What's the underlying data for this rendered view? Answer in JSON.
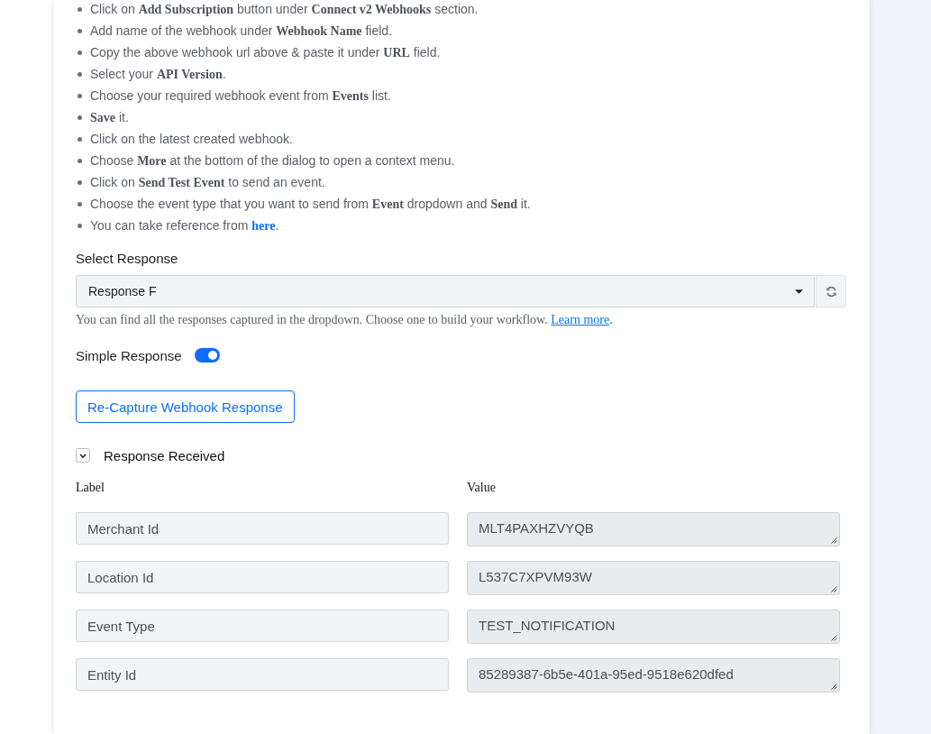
{
  "instructions": [
    {
      "text": "Click on **Add Subscription** button under **Connect v2 Webhooks** section."
    },
    {
      "text": "Add name of the webhook under **Webhook Name** field."
    },
    {
      "text": "Copy the above webhook url above & paste it under **URL** field."
    },
    {
      "text": "Select your **API Version**."
    },
    {
      "text": "Choose your required webhook event from **Events** list."
    },
    {
      "text": "**Save** it."
    },
    {
      "text": "Click on the latest created webhook."
    },
    {
      "text": "Choose **More** at the bottom of the dialog to open a context menu."
    },
    {
      "text": "Click on **Send Test Event** to send an event."
    },
    {
      "text": "Choose the event type that you want to send from **Event** dropdown and **Send** it."
    },
    {
      "text": "You can take reference from ",
      "link": "here",
      "after": "."
    }
  ],
  "select_response": {
    "label": "Select Response",
    "value": "Response F",
    "help_text": "You can find all the responses captured in the dropdown. Choose one to build your workflow. ",
    "help_link": "Learn more",
    "help_after": "."
  },
  "simple_response": {
    "label": "Simple Response",
    "on": true
  },
  "recapture_button": "Re-Capture Webhook Response",
  "response_received": {
    "title": "Response Received",
    "expanded": true,
    "columns": [
      "Label",
      "Value"
    ],
    "rows": [
      {
        "label": "Merchant Id",
        "value": "MLT4PAXHZVYQB"
      },
      {
        "label": "Location Id",
        "value": "L537C7XPVM93W"
      },
      {
        "label": "Event Type",
        "value": "TEST_NOTIFICATION"
      },
      {
        "label": "Entity Id",
        "value": "85289387-6b5e-401a-95ed-9518e620dfed"
      }
    ]
  }
}
